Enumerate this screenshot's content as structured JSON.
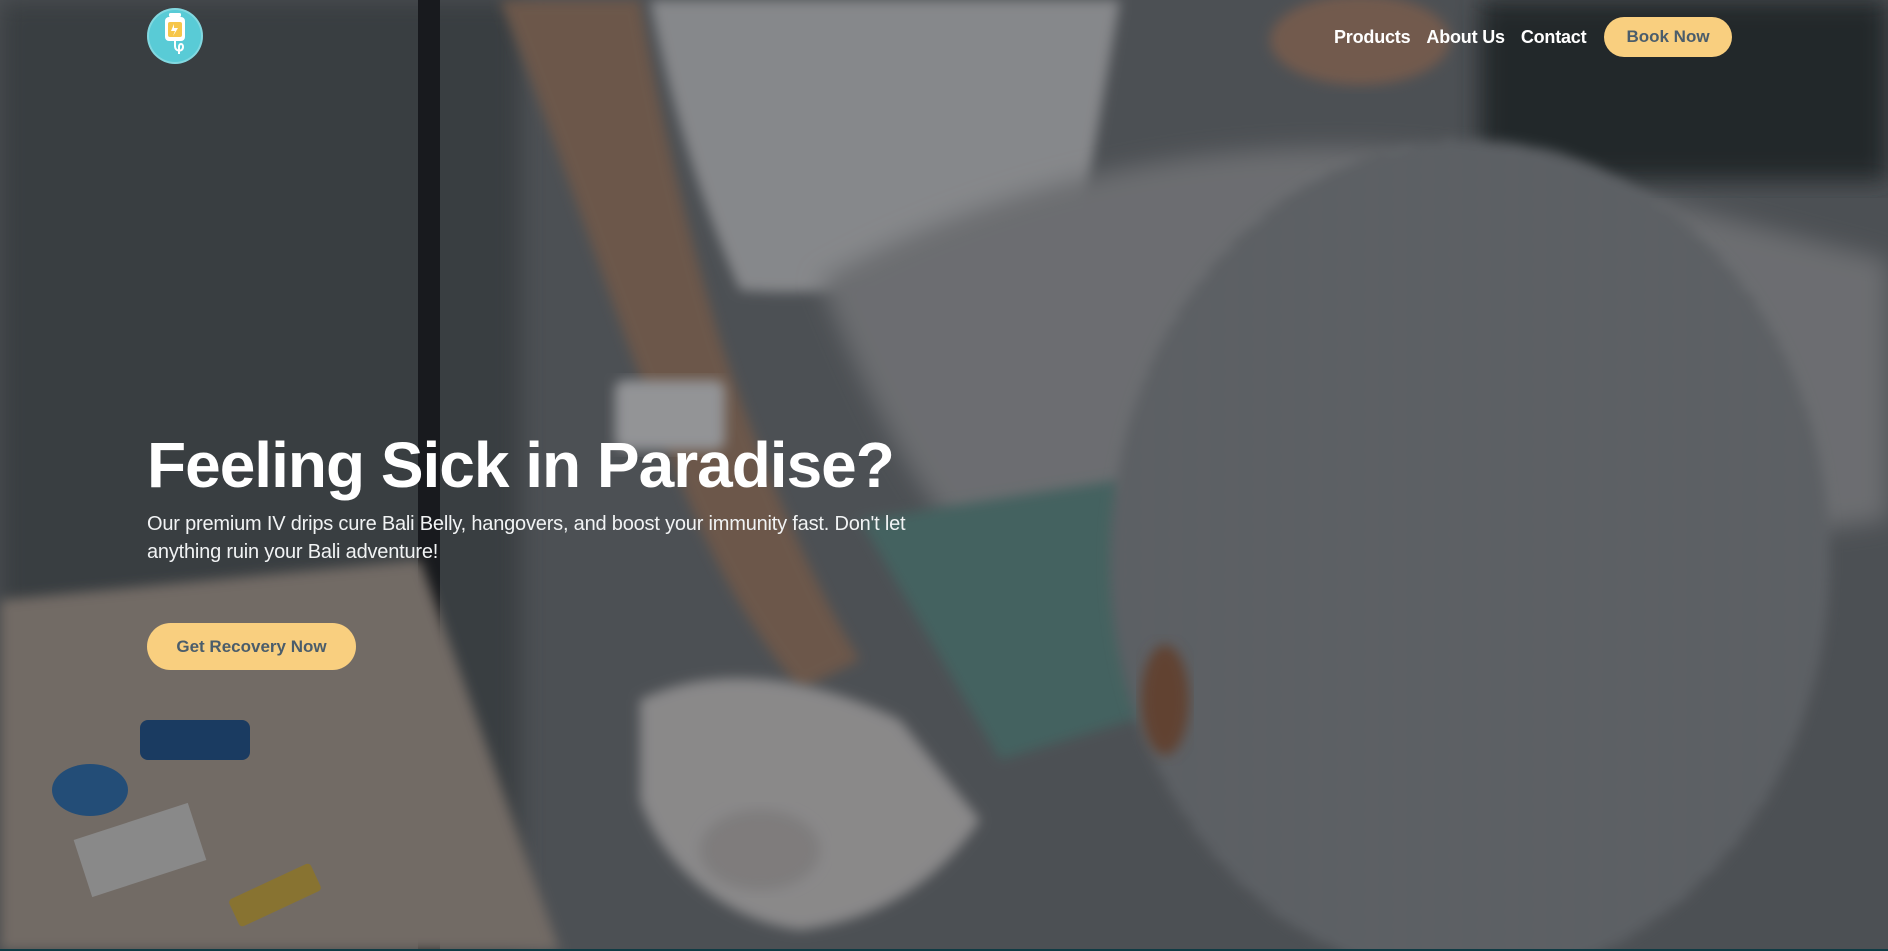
{
  "colors": {
    "accent": "#f9cf7f",
    "accent_text": "#4b5d6b",
    "logo_bg": "#59cbd6",
    "hero_text": "#ffffff"
  },
  "brand": {
    "logo_icon": "iv-bag-icon"
  },
  "nav": {
    "links": [
      "Products",
      "About Us",
      "Contact"
    ],
    "cta_label": "Book Now"
  },
  "hero": {
    "background_image": "photo-iv-drip-treatment",
    "title": "Feeling Sick in Paradise?",
    "subtitle": "Our premium IV drips cure Bali Belly, hangovers, and boost your immunity fast. Don't let anything ruin your Bali adventure!",
    "cta_label": "Get Recovery Now"
  }
}
